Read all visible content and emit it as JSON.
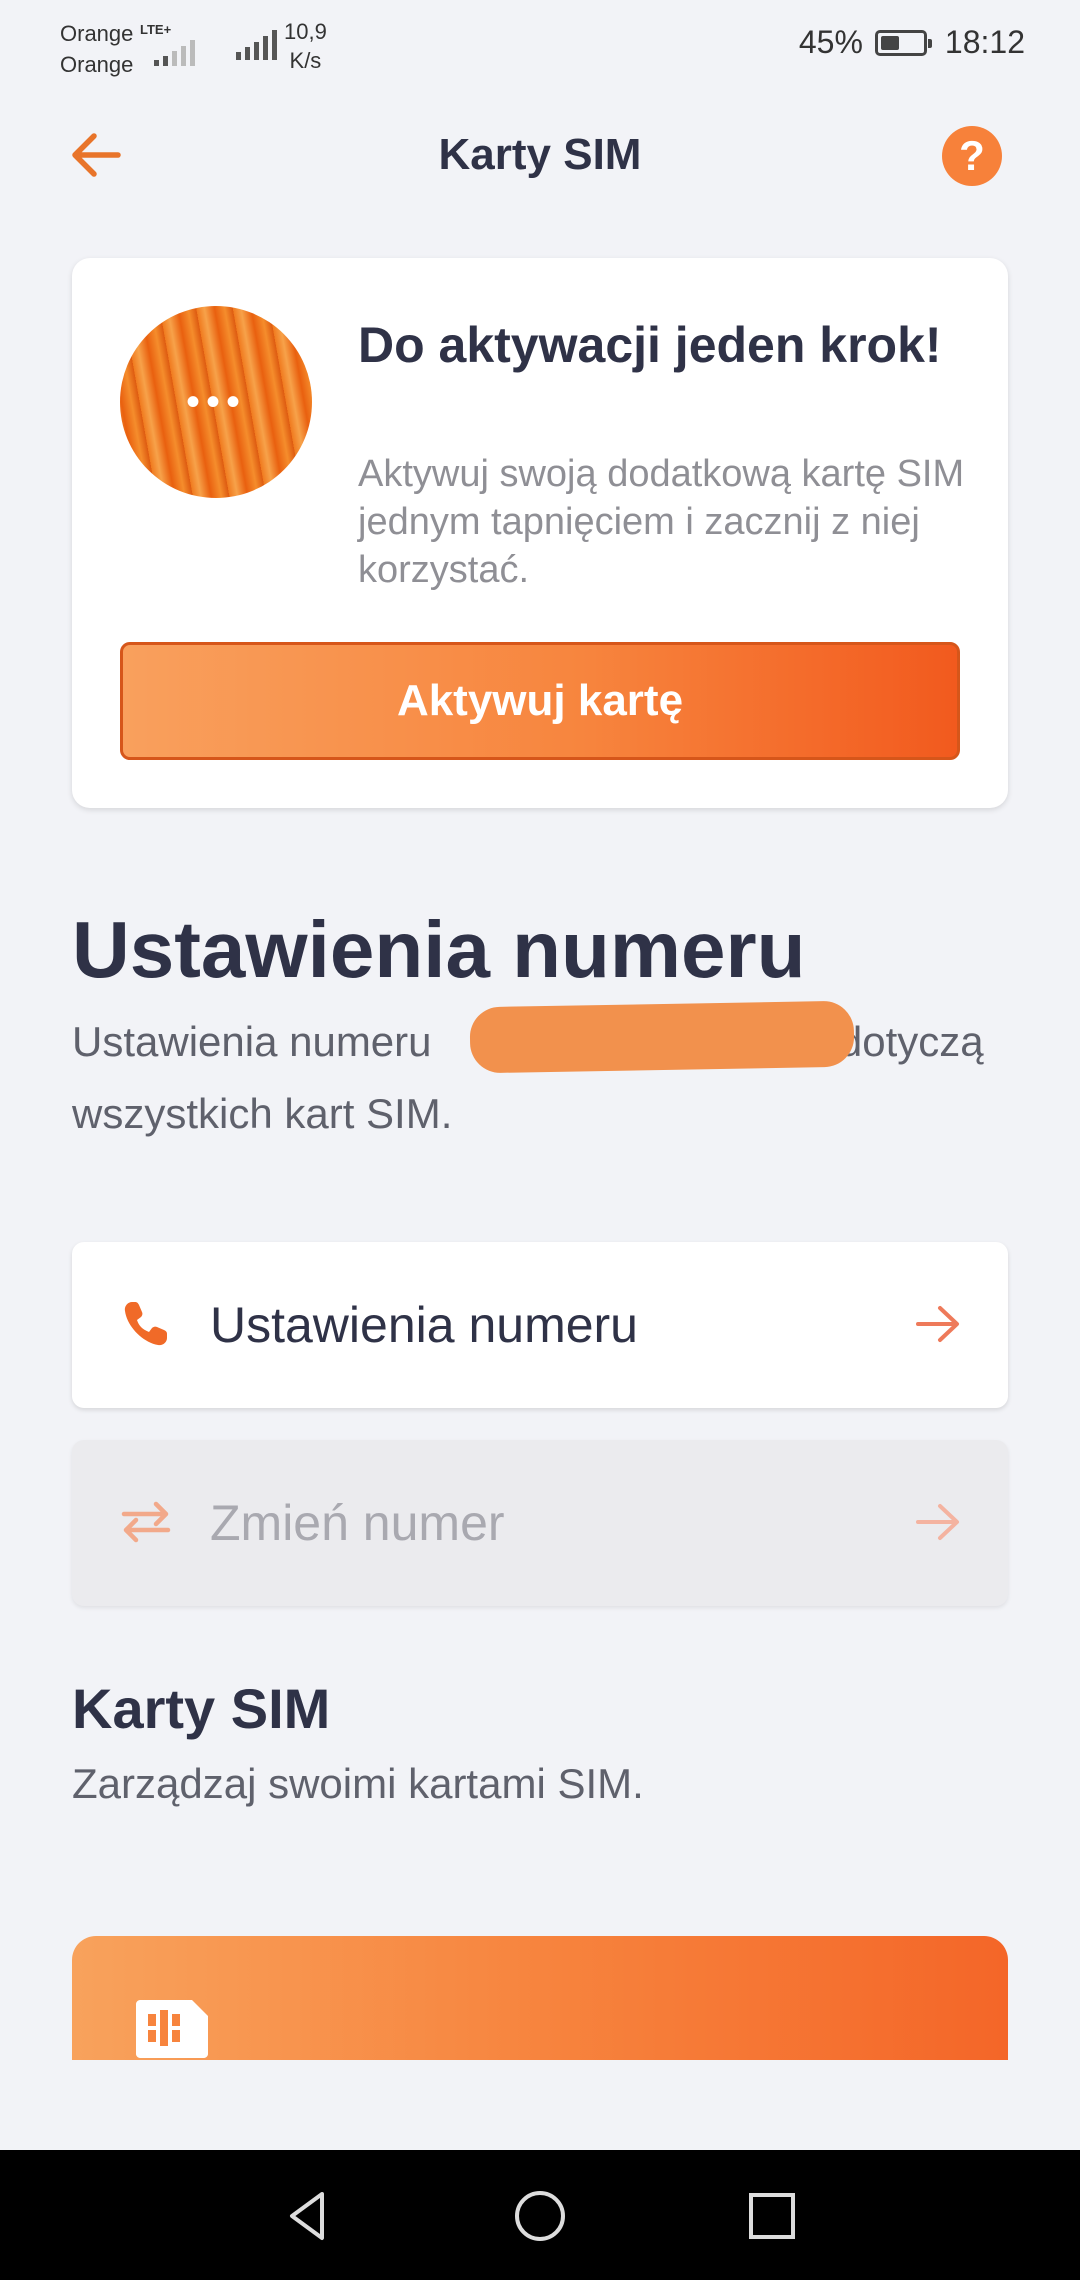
{
  "status_bar": {
    "carrier_1": "Orange",
    "carrier_2": "Orange",
    "network_type": "LTE+",
    "speed_value": "10,9",
    "speed_unit": "K/s",
    "battery_percent": "45%",
    "battery_level": 0.45,
    "time": "18:12"
  },
  "header": {
    "title": "Karty SIM",
    "back_icon": "arrow-left-icon",
    "help_icon": "question-icon",
    "help_glyph": "?"
  },
  "activation_card": {
    "avatar_glyph": "•••",
    "title": "Do aktywacji jeden krok!",
    "text": "Aktywuj swoją dodatkową kartę SIM jednym tapnięciem i zacznij z niej korzystać.",
    "button_label": "Aktywuj kartę"
  },
  "number_settings": {
    "title": "Ustawienia numeru",
    "description_before": "Ustawienia numeru",
    "description_after": "dotyczą wszystkich kart SIM.",
    "items": [
      {
        "label": "Ustawienia numeru",
        "icon": "phone-icon",
        "enabled": true
      },
      {
        "label": "Zmień numer",
        "icon": "swap-icon",
        "enabled": false
      }
    ]
  },
  "sim_cards": {
    "title": "Karty SIM",
    "description": "Zarządzaj swoimi kartami SIM.",
    "card_icon": "sim-card-icon"
  },
  "colors": {
    "accent": "#f7813a",
    "accent_dark": "#f25a1e",
    "background": "#f2f3f7",
    "text_dark": "#2f3247"
  },
  "nav_bar": {
    "back_icon": "nav-back-icon",
    "home_icon": "nav-home-icon",
    "recents_icon": "nav-recents-icon"
  }
}
